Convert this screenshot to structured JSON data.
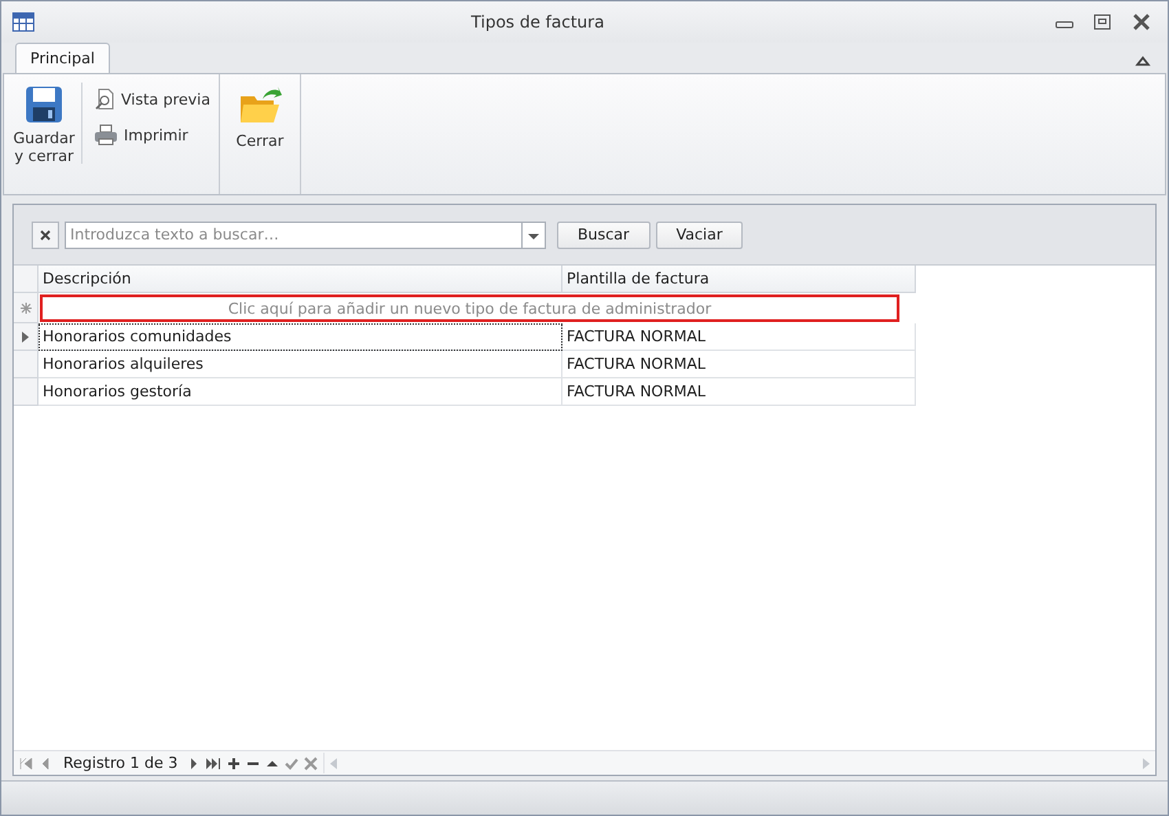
{
  "window": {
    "title": "Tipos de factura"
  },
  "ribbon": {
    "tabs": [
      {
        "label": "Principal",
        "selected": true
      }
    ],
    "groups": [
      {
        "items": [
          {
            "kind": "large",
            "label": "Guardar y cerrar"
          },
          {
            "kind": "small",
            "label": "Vista previa"
          },
          {
            "kind": "small",
            "label": "Imprimir"
          }
        ]
      },
      {
        "items": [
          {
            "kind": "large",
            "label": "Cerrar"
          }
        ]
      }
    ]
  },
  "search": {
    "placeholder": "Introduzca texto a buscar…",
    "buttons": [
      "Buscar",
      "Vaciar"
    ]
  },
  "grid": {
    "columns": [
      "Descripción",
      "Plantilla de factura"
    ],
    "new_row_prompt": "Clic aquí para añadir un nuevo tipo de factura de administrador",
    "rows": [
      {
        "cells": [
          "Honorarios comunidades",
          "FACTURA NORMAL"
        ],
        "selected": true
      },
      {
        "cells": [
          "Honorarios alquileres",
          "FACTURA NORMAL"
        ],
        "selected": false
      },
      {
        "cells": [
          "Honorarios gestoría",
          "FACTURA NORMAL"
        ],
        "selected": false
      }
    ]
  },
  "navigator": {
    "text": "Registro 1 de 3"
  }
}
